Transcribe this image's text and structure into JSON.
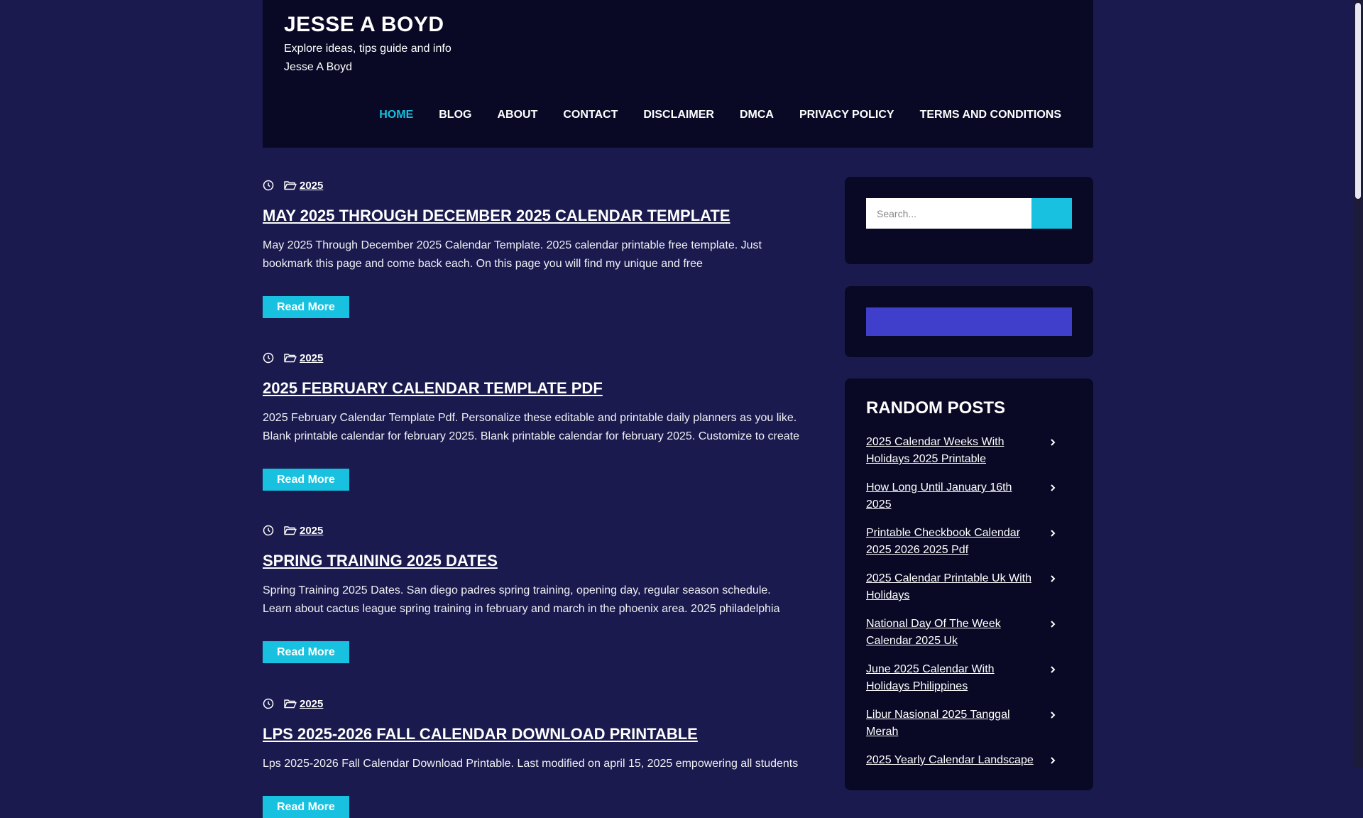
{
  "site": {
    "title": "JESSE A BOYD",
    "tagline": "Explore ideas, tips guide and info",
    "author": "Jesse A Boyd"
  },
  "nav": [
    "HOME",
    "BLOG",
    "ABOUT",
    "CONTACT",
    "DISCLAIMER",
    "DMCA",
    "PRIVACY POLICY",
    "TERMS AND CONDITIONS"
  ],
  "posts": [
    {
      "category": "2025",
      "title": "MAY 2025 THROUGH DECEMBER 2025 CALENDAR TEMPLATE",
      "excerpt": "May 2025 Through December 2025 Calendar Template. 2025 calendar printable free template. Just bookmark this page and come back each. On this page you will find my unique and free",
      "read_more": "Read More"
    },
    {
      "category": "2025",
      "title": "2025 FEBRUARY CALENDAR TEMPLATE PDF",
      "excerpt": "2025 February Calendar Template Pdf. Personalize these editable and printable daily planners as you like. Blank printable calendar for february 2025. Blank printable calendar for february 2025. Customize to create",
      "read_more": "Read More"
    },
    {
      "category": "2025",
      "title": "SPRING TRAINING 2025 DATES",
      "excerpt": "Spring Training 2025 Dates. San diego padres spring training, opening day, regular season schedule. Learn about cactus league spring training in february and march in the phoenix area. 2025 philadelphia",
      "read_more": "Read More"
    },
    {
      "category": "2025",
      "title": "LPS 2025-2026 FALL CALENDAR DOWNLOAD PRINTABLE",
      "excerpt": "Lps 2025-2026 Fall Calendar Download Printable. Last modified on april 15, 2025 empowering all students",
      "read_more": "Read More"
    }
  ],
  "search": {
    "placeholder": "Search..."
  },
  "random_posts": {
    "title": "RANDOM POSTS",
    "items": [
      "2025 Calendar Weeks With Holidays 2025 Printable",
      "How Long Until January 16th 2025",
      "Printable Checkbook Calendar 2025 2026 2025 Pdf",
      "2025 Calendar Printable Uk With Holidays",
      "National Day Of The Week Calendar 2025 Uk",
      "June 2025 Calendar With Holidays Philippines",
      "Libur Nasional 2025 Tanggal Merah",
      "2025 Yearly Calendar Landscape"
    ]
  },
  "colors": {
    "background": "#1a1a4e",
    "panel": "#090925",
    "accent": "#17c1df",
    "purple": "#3f3fcc"
  }
}
